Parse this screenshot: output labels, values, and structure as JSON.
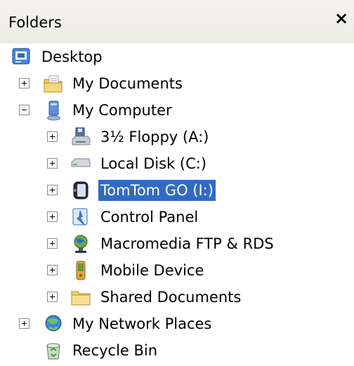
{
  "header": {
    "title": "Folders",
    "close_glyph": "×"
  },
  "tree": {
    "items": [
      {
        "label": "Desktop",
        "icon": "desktop-icon",
        "expander": "none"
      },
      {
        "label": "My Documents",
        "icon": "my-documents-icon",
        "expander": "plus"
      },
      {
        "label": "My Computer",
        "icon": "my-computer-icon",
        "expander": "minus"
      },
      {
        "label": "3½ Floppy (A:)",
        "icon": "floppy-drive-icon",
        "expander": "plus"
      },
      {
        "label": "Local Disk (C:)",
        "icon": "hard-disk-icon",
        "expander": "plus"
      },
      {
        "label": "TomTom GO (I:)",
        "icon": "removable-drive-icon",
        "expander": "plus",
        "selected": true
      },
      {
        "label": "Control Panel",
        "icon": "control-panel-icon",
        "expander": "plus"
      },
      {
        "label": "Macromedia FTP & RDS",
        "icon": "ftp-globe-icon",
        "expander": "plus"
      },
      {
        "label": "Mobile Device",
        "icon": "mobile-device-icon",
        "expander": "plus"
      },
      {
        "label": "Shared Documents",
        "icon": "folder-icon",
        "expander": "plus"
      },
      {
        "label": "My Network Places",
        "icon": "network-places-icon",
        "expander": "plus"
      },
      {
        "label": "Recycle Bin",
        "icon": "recycle-bin-icon",
        "expander": "none"
      }
    ]
  },
  "colors": {
    "selection": "#316ac5",
    "header_bg": "#ecebe4"
  }
}
